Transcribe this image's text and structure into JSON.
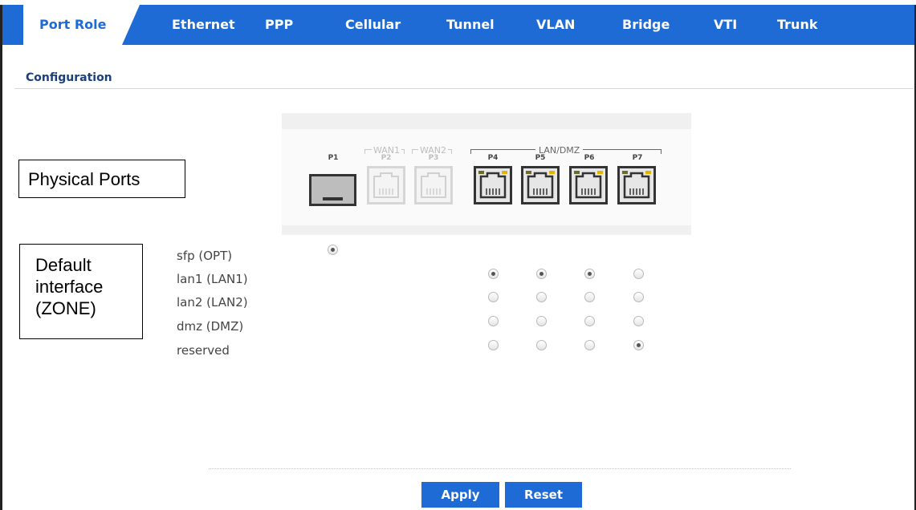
{
  "tabs": [
    {
      "label": "Port Role",
      "active": true
    },
    {
      "label": "Ethernet"
    },
    {
      "label": "PPP"
    },
    {
      "label": "Cellular"
    },
    {
      "label": "Tunnel"
    },
    {
      "label": "VLAN"
    },
    {
      "label": "Bridge"
    },
    {
      "label": "VTI"
    },
    {
      "label": "Trunk"
    }
  ],
  "section_title": "Configuration",
  "callouts": {
    "physical_ports": "Physical Ports",
    "default_interface_lines": [
      "Default",
      "interface",
      "(ZONE)"
    ]
  },
  "ports": {
    "groups": {
      "wan1": "WAN1",
      "wan2": "WAN2",
      "lan_dmz": "LAN/DMZ"
    },
    "labels": [
      "P1",
      "P2",
      "P3",
      "P4",
      "P5",
      "P6",
      "P7"
    ],
    "disabled": [
      "P2",
      "P3"
    ]
  },
  "interfaces": [
    {
      "label": "sfp (OPT)",
      "selected_on": [
        "P1"
      ]
    },
    {
      "label": "lan1 (LAN1)",
      "selected_on": [
        "P4",
        "P5",
        "P6"
      ]
    },
    {
      "label": "lan2 (LAN2)",
      "selected_on": []
    },
    {
      "label": "dmz (DMZ)",
      "selected_on": []
    },
    {
      "label": "reserved",
      "selected_on": [
        "P7"
      ]
    }
  ],
  "buttons": {
    "apply": "Apply",
    "reset": "Reset"
  },
  "colors": {
    "accent": "#1e6bd6",
    "tab_active_text": "#1e6bd6",
    "title": "#1a3f7a"
  }
}
